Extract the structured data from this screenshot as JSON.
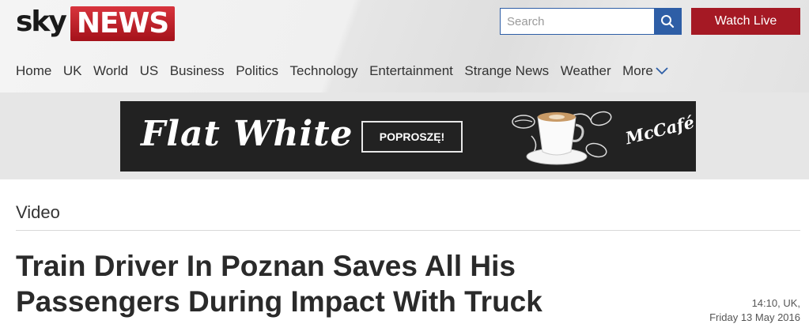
{
  "logo": {
    "sky": "sky",
    "news": "NEWS"
  },
  "search": {
    "placeholder": "Search",
    "button_icon": "search-icon"
  },
  "watch_live": {
    "label": "Watch Live"
  },
  "nav": {
    "items": [
      {
        "label": "Home"
      },
      {
        "label": "UK"
      },
      {
        "label": "World"
      },
      {
        "label": "US"
      },
      {
        "label": "Business"
      },
      {
        "label": "Politics"
      },
      {
        "label": "Technology"
      },
      {
        "label": "Entertainment"
      },
      {
        "label": "Strange News"
      },
      {
        "label": "Weather"
      },
      {
        "label": "More",
        "icon": "chevron-down-icon"
      }
    ]
  },
  "ad": {
    "headline": "Flat White",
    "cta": "POPROSZĘ!",
    "brand": "McCafé"
  },
  "article": {
    "section": "Video",
    "title": "Train Driver In Poznan Saves All His Passengers During Impact With Truck",
    "time": "14:10, UK,",
    "date": "Friday 13 May 2016"
  },
  "colors": {
    "brand_red": "#a51924",
    "search_blue": "#2e5ea6",
    "ad_background": "#222222"
  }
}
